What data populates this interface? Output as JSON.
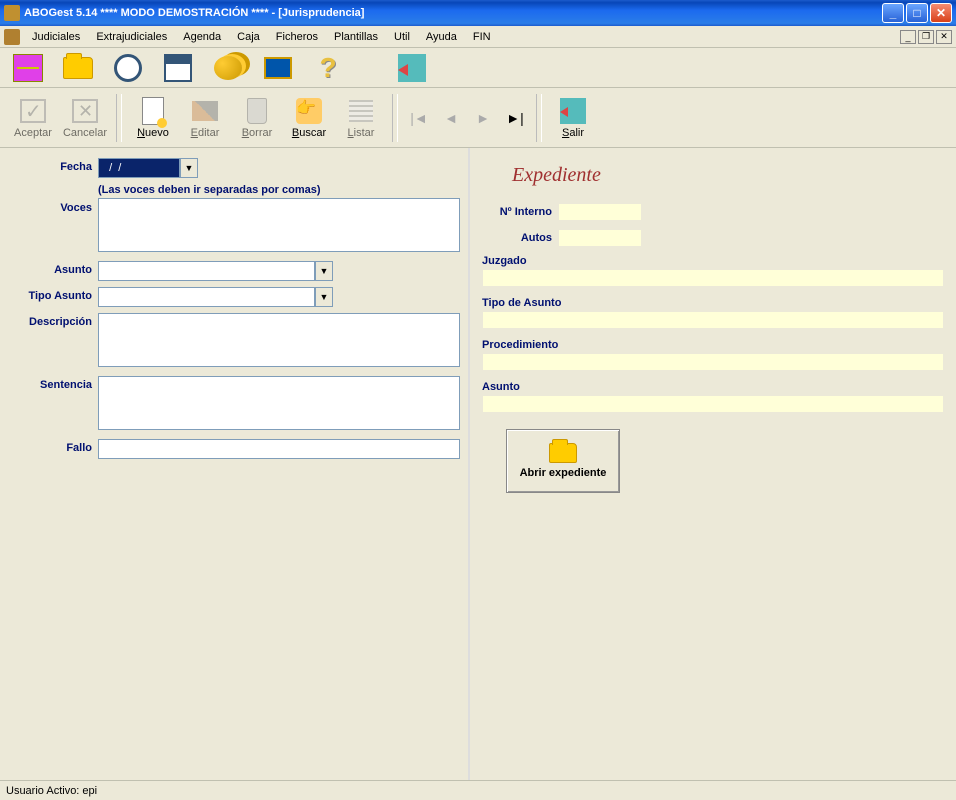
{
  "title": "ABOGest 5.14 **** MODO DEMOSTRACIÓN ****  - [Jurisprudencia]",
  "menu": [
    "Judiciales",
    "Extrajudiciales",
    "Agenda",
    "Caja",
    "Ficheros",
    "Plantillas",
    "Util",
    "Ayuda",
    "FIN"
  ],
  "toolbar2": {
    "aceptar": "Aceptar",
    "cancelar": "Cancelar",
    "nuevo": "Nuevo",
    "editar": "Editar",
    "borrar": "Borrar",
    "buscar": "Buscar",
    "listar": "Listar",
    "salir": "Salir"
  },
  "form": {
    "fecha_label": "Fecha",
    "fecha_value": "  /  /",
    "voces_label": "Voces",
    "voces_hint": "(Las voces deben ir separadas por comas)",
    "voces_value": "",
    "asunto_label": "Asunto",
    "asunto_value": "",
    "tipoasunto_label": "Tipo Asunto",
    "tipoasunto_value": "",
    "descripcion_label": "Descripción",
    "descripcion_value": "",
    "sentencia_label": "Sentencia",
    "sentencia_value": "",
    "fallo_label": "Fallo",
    "fallo_value": ""
  },
  "expediente": {
    "title": "Expediente",
    "nointerno_label": "Nº Interno",
    "nointerno_value": "",
    "autos_label": "Autos",
    "autos_value": "",
    "juzgado_label": "Juzgado",
    "juzgado_value": "",
    "tipoasunto_label": "Tipo de Asunto",
    "tipoasunto_value": "",
    "procedimiento_label": "Procedimiento",
    "procedimiento_value": "",
    "asunto_label": "Asunto",
    "asunto_value": "",
    "open_label": "Abrir expediente"
  },
  "status": "Usuario Activo: epi"
}
